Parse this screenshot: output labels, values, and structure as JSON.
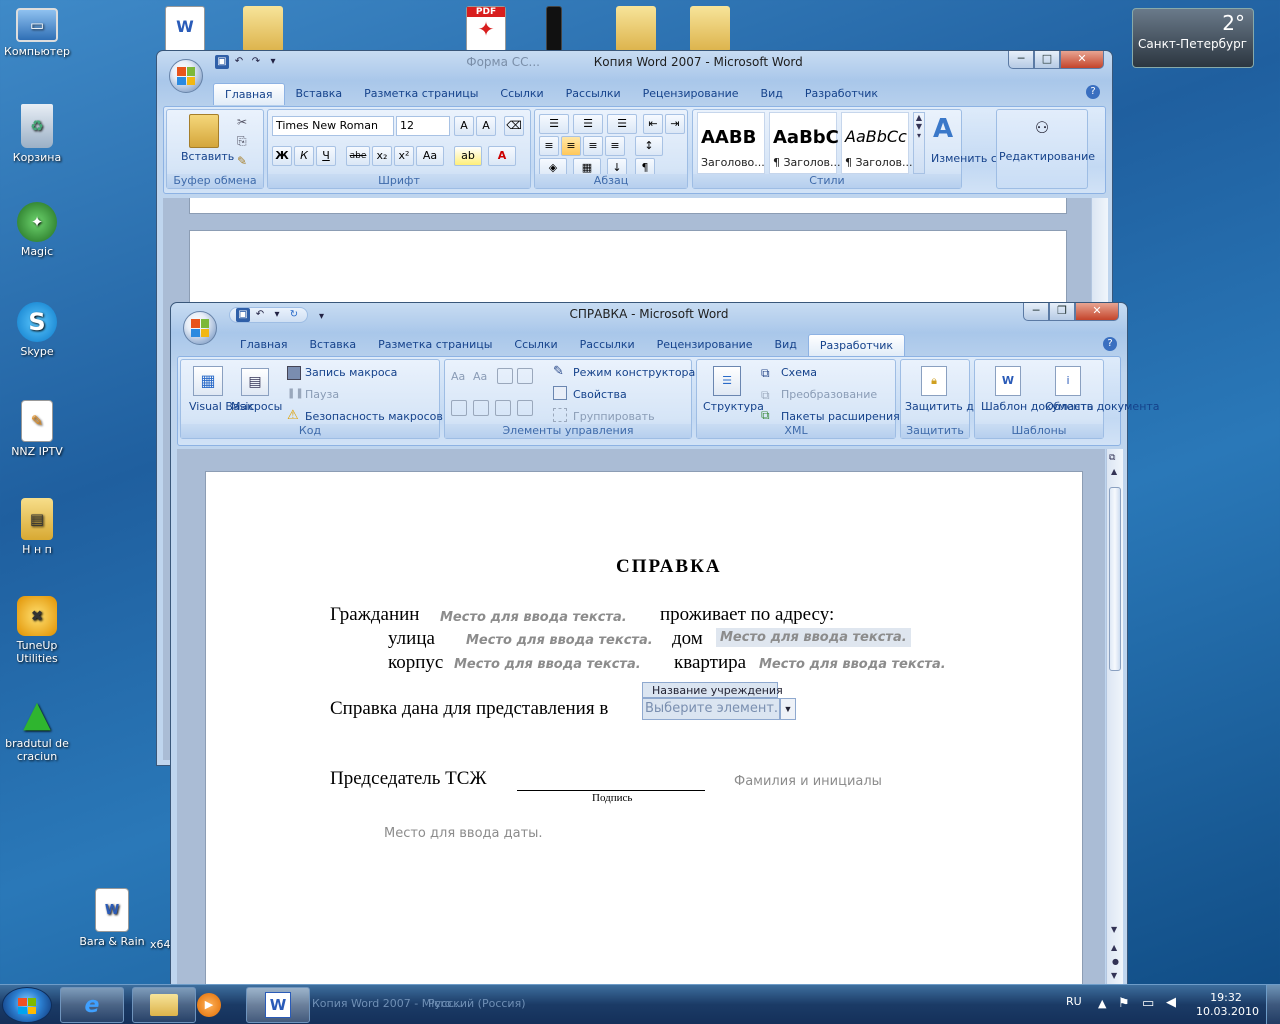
{
  "desktop": {
    "icons": [
      {
        "label": "Компьютер",
        "icon": "computer-icon",
        "color": "#5c8fc9"
      },
      {
        "label": "Корзина",
        "icon": "recycle-bin-icon",
        "color": "#9bb4cc"
      },
      {
        "label": "Magic",
        "icon": "magic-shield-icon",
        "color": "#3a7a3a"
      },
      {
        "label": "Skype",
        "icon": "skype-icon",
        "color": "#1ba1e2"
      },
      {
        "label": "NNZ IPTV",
        "icon": "iptv-icon",
        "color": "#f0a020"
      },
      {
        "label": "Н н п",
        "icon": "folder-icon",
        "color": "#e8c25a"
      },
      {
        "label": "TuneUp Utilities",
        "icon": "tuneup-icon",
        "color": "#f3b515"
      },
      {
        "label": "bradutul de craciun",
        "icon": "christmas-tree-icon",
        "color": "#2f8f2f"
      }
    ],
    "bottom_icon": {
      "label": "Bara & Rain",
      "icon": "word-document-icon"
    },
    "bottom_icon_partial": "x64",
    "weather": {
      "temp": "2°",
      "city": "Санкт-Петербург"
    }
  },
  "back_window": {
    "title": "Копия Word 2007 - Microsoft Word",
    "title_faint": "Форма СС...",
    "tabs": [
      "Главная",
      "Вставка",
      "Разметка страницы",
      "Ссылки",
      "Рассылки",
      "Рецензирование",
      "Вид",
      "Разработчик"
    ],
    "active_tab": "Главная",
    "clipboard": {
      "paste": "Вставить",
      "label": "Буфер обмена"
    },
    "font": {
      "name": "Times New Roman",
      "size": "12",
      "label": "Шрифт",
      "buttons": [
        "Ж",
        "К",
        "Ч",
        "abe",
        "x₂",
        "x²",
        "Aa"
      ]
    },
    "paragraph": {
      "label": "Абзац"
    },
    "styles": {
      "label": "Стили",
      "items": [
        {
          "preview": "AABB",
          "name": "Заголово..."
        },
        {
          "preview": "AaBbC",
          "name": "¶ Заголов..."
        },
        {
          "preview": "AaBbCc",
          "name": "¶ Заголов..."
        }
      ],
      "change": "Изменить стили"
    },
    "editing": {
      "label": "Редактирование"
    }
  },
  "front_window": {
    "title": "СПРАВКА - Microsoft Word",
    "tabs": [
      "Главная",
      "Вставка",
      "Разметка страницы",
      "Ссылки",
      "Рассылки",
      "Рецензирование",
      "Вид",
      "Разработчик"
    ],
    "active_tab": "Разработчик",
    "code": {
      "vb": "Visual Basic",
      "macros": "Макросы",
      "record": "Запись макроса",
      "pause": "Пауза",
      "security": "Безопасность макросов",
      "label": "Код"
    },
    "controls": {
      "design": "Режим конструктора",
      "properties": "Свойства",
      "group": "Группировать",
      "label": "Элементы управления"
    },
    "xml": {
      "structure": "Структура",
      "schema": "Схема",
      "transform": "Преобразование",
      "packs": "Пакеты расширения",
      "label": "XML"
    },
    "protect": {
      "button": "Защитить документ",
      "label": "Защитить"
    },
    "templates": {
      "template": "Шаблон документа",
      "area": "Область документа",
      "label": "Шаблоны"
    }
  },
  "document": {
    "heading": "СПРАВКА",
    "citizen": "Гражданин",
    "lives": "проживает по адресу:",
    "street": "улица",
    "house": "дом",
    "building": "корпус",
    "flat": "квартира",
    "placeholder": "Место для ввода текста.",
    "given_for": "Справка дана для представления в",
    "dropdown_title": "Название учреждения",
    "dropdown_value": "Выберите элемент.",
    "chairman": "Председатель ТСЖ",
    "signature_label": "Подпись",
    "name_placeholder": "Фамилия и инициалы",
    "date_placeholder": "Место для ввода даты."
  },
  "taskbar": {
    "language": "RU",
    "time": "19:32",
    "date": "10.03.2010",
    "faint_items": [
      "Копия Word 2007 - Micro...",
      "Русский (Россия)"
    ]
  }
}
